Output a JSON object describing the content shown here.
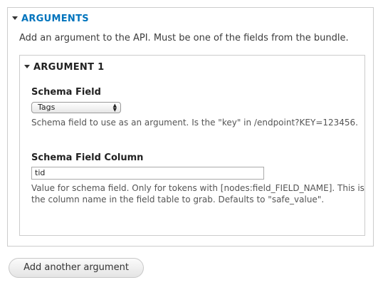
{
  "arguments": {
    "legend": "ARGUMENTS",
    "description": "Add an argument to the API. Must be one of the fields from the bundle.",
    "argument1": {
      "legend": "ARGUMENT 1",
      "schema_field": {
        "label": "Schema Field",
        "selected": "Tags",
        "description": "Schema field to use as an argument. Is the \"key\" in /endpoint?KEY=123456."
      },
      "schema_field_column": {
        "label": "Schema Field Column",
        "value": "tid",
        "description_line1": "Value for schema field. Only for tokens with [nodes:field_FIELD_NAME]. This is",
        "description_line2": "the column name in the field table to grab. Defaults to \"safe_value\"."
      }
    }
  },
  "add_button": {
    "label": "Add another argument"
  },
  "icons": {
    "collapse": "triangle-down-icon",
    "select": "select-arrows-icon"
  }
}
